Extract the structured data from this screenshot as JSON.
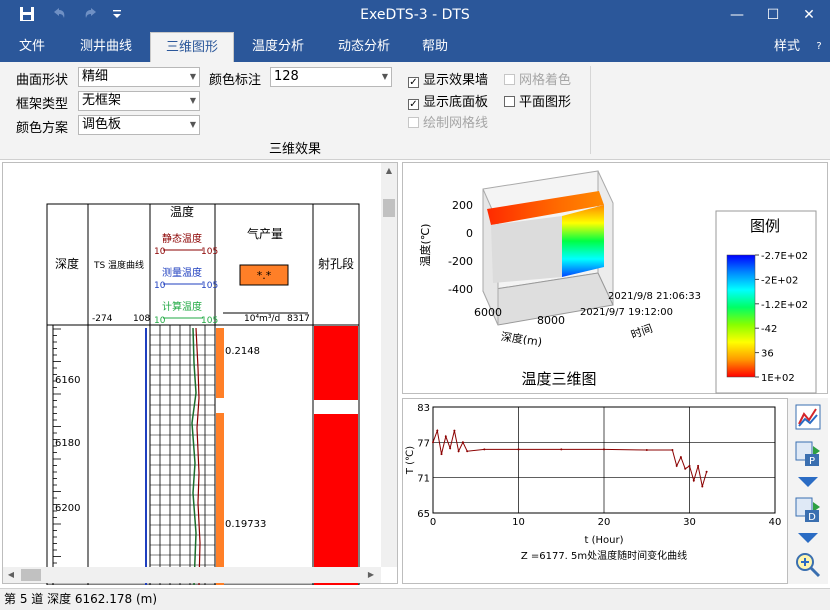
{
  "app": {
    "title": "ExeDTS-3 - DTS"
  },
  "window_controls": {
    "minimize": "—",
    "maximize": "☐",
    "close": "✕"
  },
  "menu": {
    "tabs": [
      "文件",
      "测井曲线",
      "三维图形",
      "温度分析",
      "动态分析",
      "帮助"
    ],
    "active_tab": "三维图形",
    "style_label": "样式",
    "help_icon": "?"
  },
  "ribbon": {
    "surface_shape_label": "曲面形状",
    "surface_shape_value": "精细",
    "frame_type_label": "框架类型",
    "frame_type_value": "无框架",
    "color_scheme_label": "颜色方案",
    "color_scheme_value": "调色板",
    "color_marker_label": "颜色标注",
    "color_marker_value": "128",
    "checkboxes": {
      "show_wall": {
        "label": "显示效果墙",
        "checked": true,
        "enabled": true
      },
      "show_floor": {
        "label": "显示底面板",
        "checked": true,
        "enabled": true
      },
      "draw_grid": {
        "label": "绘制网格线",
        "checked": false,
        "enabled": false
      },
      "grid_color": {
        "label": "网格着色",
        "checked": false,
        "enabled": false
      },
      "flat_plot": {
        "label": "平面图形",
        "checked": false,
        "enabled": true
      }
    },
    "group_label": "三维效果"
  },
  "log": {
    "header": {
      "depth": "深度",
      "ts_curve": "TS 温度曲线",
      "temperature": "温度",
      "static_temp": "静态温度",
      "measured_temp": "测量温度",
      "calc_temp": "计算温度",
      "range_start": "10",
      "range_end": "105",
      "ts_min": "-274",
      "ts_max": "108",
      "gas": "气产量",
      "gas_badge": "*.*",
      "gas_unit": "10⁴m³/d",
      "gas_max": "8317",
      "perf": "射孔段"
    },
    "depth_labels": [
      "6160",
      "6180",
      "6200"
    ],
    "gas_values": [
      "0.2148",
      "0.19733"
    ]
  },
  "plot3d": {
    "title": "温度三维图",
    "z_axis_label": "温度(℃)",
    "x_axis_label": "深度(m)",
    "y_axis_label": "时间",
    "z_ticks": [
      "200",
      "0",
      "-200",
      "-400"
    ],
    "x_ticks": [
      "6000",
      "8000"
    ],
    "y_ticks": [
      "2021/9/8 21:06:33",
      "2021/9/7 19:12:00"
    ],
    "legend_title": "图例",
    "legend_values": [
      "-2.7E+02",
      "-2E+02",
      "-1.2E+02",
      "-42",
      "36",
      "1E+02"
    ],
    "colormap": [
      "#0000ff",
      "#0088ff",
      "#00ffff",
      "#00ff66",
      "#88ff00",
      "#ffff00",
      "#ff9900",
      "#ff0000"
    ]
  },
  "chart_data": {
    "type": "line",
    "title": "Z =6177. 5m处温度随时间变化曲线",
    "xlabel": "t (Hour)",
    "ylabel": "T (℃)",
    "xlim": [
      0,
      40
    ],
    "ylim": [
      65,
      83
    ],
    "x_ticks": [
      0,
      10,
      20,
      30,
      40
    ],
    "y_ticks": [
      65,
      71,
      77,
      83
    ],
    "series": [
      {
        "color": "#8b0000",
        "x": [
          0,
          0.5,
          1,
          1.5,
          2,
          2.5,
          3,
          3.5,
          4,
          6,
          10,
          15,
          20,
          25,
          28,
          28.5,
          29,
          29.5,
          30,
          30.5,
          31,
          31.5,
          32
        ],
        "y": [
          77,
          79,
          75,
          78,
          76,
          79,
          75.5,
          77,
          75.5,
          75.8,
          75.8,
          75.8,
          75.8,
          75.7,
          75.7,
          73,
          74.5,
          72.5,
          73,
          70.5,
          73,
          69.5,
          72
        ]
      }
    ]
  },
  "toolbar_right": {
    "icons": [
      "chart-analysis-icon",
      "export-p-icon",
      "arrow-down-icon",
      "export-d-icon",
      "arrow-down-icon",
      "zoom-icon"
    ],
    "p_label": "P",
    "d_label": "D"
  },
  "status": {
    "text": "第 5 道 深度 6162.178 (m)"
  }
}
